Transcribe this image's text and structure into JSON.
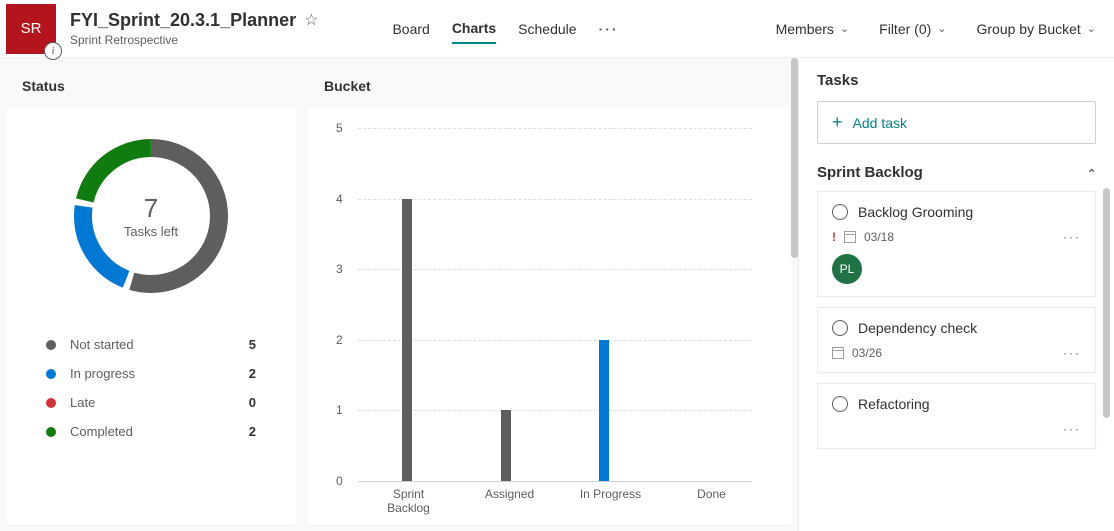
{
  "header": {
    "avatar_initials": "SR",
    "title": "FYI_Sprint_20.3.1_Planner",
    "subtitle": "Sprint Retrospective",
    "tabs": {
      "board": "Board",
      "charts": "Charts",
      "schedule": "Schedule"
    },
    "members": "Members",
    "filter": "Filter (0)",
    "group_by": "Group by Bucket"
  },
  "status": {
    "title": "Status",
    "center_value": "7",
    "center_label": "Tasks left",
    "legend": {
      "not_started": {
        "label": "Not started",
        "value": "5",
        "color": "#605e5c"
      },
      "in_progress": {
        "label": "In progress",
        "value": "2",
        "color": "#0078d4"
      },
      "late": {
        "label": "Late",
        "value": "0",
        "color": "#d13438"
      },
      "completed": {
        "label": "Completed",
        "value": "2",
        "color": "#107c10"
      }
    }
  },
  "bucket": {
    "title": "Bucket"
  },
  "chart_data": {
    "type": "bar",
    "categories": [
      "Sprint\nBacklog",
      "Assigned",
      "In Progress",
      "Done"
    ],
    "series": [
      {
        "name": "Not started",
        "color": "#605e5c",
        "values": [
          4,
          1,
          0,
          0
        ]
      },
      {
        "name": "In progress",
        "color": "#0078d4",
        "values": [
          0,
          0,
          2,
          0
        ]
      }
    ],
    "ylim": [
      0,
      5
    ],
    "yticks": [
      0,
      1,
      2,
      3,
      4,
      5
    ]
  },
  "right": {
    "tasks_title": "Tasks",
    "add_task": "Add task",
    "bucket_name": "Sprint Backlog",
    "tasks": [
      {
        "title": "Backlog Grooming",
        "urgent": true,
        "date": "03/18",
        "assignee": "PL"
      },
      {
        "title": "Dependency check",
        "urgent": false,
        "date": "03/26",
        "assignee": null
      },
      {
        "title": "Refactoring",
        "urgent": false,
        "date": null,
        "assignee": null
      }
    ]
  }
}
